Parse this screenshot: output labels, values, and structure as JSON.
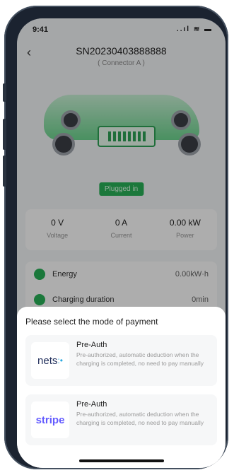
{
  "status": {
    "time": "9:41",
    "signal": "..ıl",
    "wifi": "≋",
    "battery": "▬"
  },
  "nav": {
    "title": "SN20230403888888",
    "subtitle": "( Connector A )",
    "back": "‹"
  },
  "charging": {
    "status_badge": "Plugged in"
  },
  "metrics": [
    {
      "value": "0 V",
      "label": "Voltage"
    },
    {
      "value": "0 A",
      "label": "Current"
    },
    {
      "value": "0.00 kW",
      "label": "Power"
    }
  ],
  "list": [
    {
      "label": "Energy",
      "value": "0.00kW·h"
    },
    {
      "label": "Charging duration",
      "value": "0min"
    }
  ],
  "payment_sheet": {
    "title": "Please select the mode of payment",
    "options": [
      {
        "logo": "nets",
        "title": "Pre-Auth",
        "description": "Pre-authorized, automatic deduction when the charging is completed, no need to pay manually"
      },
      {
        "logo": "stripe",
        "title": "Pre-Auth",
        "description": "Pre-authorized, automatic deduction when the charging is completed, no need to pay manually"
      }
    ]
  },
  "colors": {
    "accent": "#28b157",
    "stripe": "#635bff",
    "nets": "#1f2d5a",
    "frame": "#1b2330"
  }
}
